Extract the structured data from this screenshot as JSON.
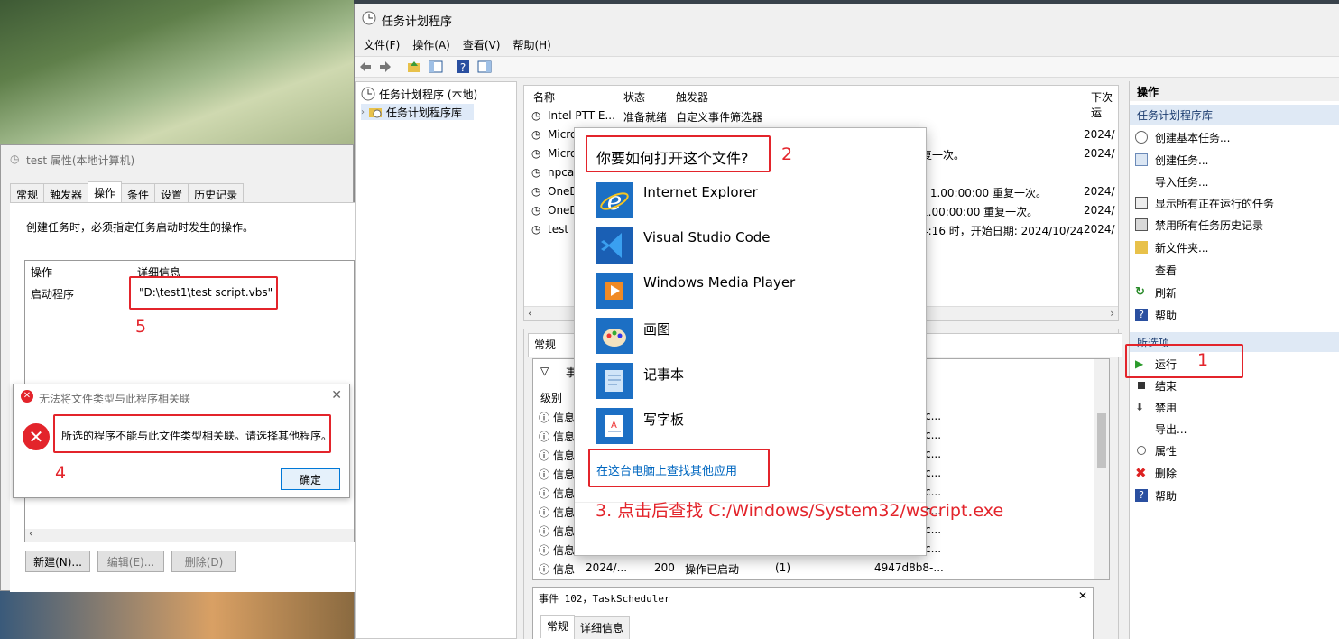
{
  "task_scheduler": {
    "title": "任务计划程序",
    "menu": [
      "文件(F)",
      "操作(A)",
      "查看(V)",
      "帮助(H)"
    ],
    "tree": {
      "root": "任务计划程序 (本地)",
      "library": "任务计划程序库"
    },
    "columns": [
      "名称",
      "状态",
      "触发器",
      "下次运"
    ],
    "rows": [
      {
        "name": "Intel PTT E...",
        "status": "准备就绪",
        "trigger": "自定义事件筛选器",
        "next": ""
      },
      {
        "name": "Micro",
        "status": "",
        "trigger": "",
        "next": "2024/"
      },
      {
        "name": "Micro",
        "status": "",
        "trigger": "复一次。",
        "next": "2024/"
      },
      {
        "name": "npcap",
        "status": "",
        "trigger": "",
        "next": ""
      },
      {
        "name": "OneD",
        "status": "",
        "trigger": "为 1.00:00:00 重复一次。",
        "next": "2024/"
      },
      {
        "name": "OneD",
        "status": "",
        "trigger": "1.00:00:00 重复一次。",
        "next": "2024/"
      },
      {
        "name": "test",
        "status": "",
        "trigger": "4:16 时，开始日期: 2024/10/24",
        "next": "2024/"
      }
    ],
    "lower_tab": "常规",
    "history_header": "事",
    "level_header": "级别",
    "events": [
      {
        "level": "信息",
        "tail": "c..."
      },
      {
        "level": "信息",
        "tail": "c..."
      },
      {
        "level": "信息",
        "tail": "c..."
      },
      {
        "level": "信息",
        "tail": "c..."
      },
      {
        "level": "信息",
        "tail": "c..."
      },
      {
        "level": "信息",
        "tail": "c..."
      },
      {
        "level": "信息",
        "tail": "c..."
      },
      {
        "level": "信息",
        "tail": "c..."
      },
      {
        "level": "信息",
        "tail": "..."
      },
      {
        "level": "信息",
        "date": "2024/...",
        "id": "200",
        "category": "操作已启动",
        "op": "(1)",
        "tail": "4947d8b8-..."
      }
    ],
    "event_panel": {
      "title": "事件 102，TaskScheduler",
      "tabs": [
        "常规",
        "详细信息"
      ],
      "close": "✕"
    },
    "behind_button": "确定"
  },
  "actions": {
    "header": "操作",
    "group1": "任务计划程序库",
    "items1": [
      "创建基本任务...",
      "创建任务...",
      "导入任务...",
      "显示所有正在运行的任务",
      "禁用所有任务历史记录",
      "新文件夹...",
      "查看",
      "刷新",
      "帮助"
    ],
    "group2": "所选项",
    "items2": [
      "运行",
      "结束",
      "禁用",
      "导出...",
      "属性",
      "删除",
      "帮助"
    ]
  },
  "props": {
    "title": "test 属性(本地计算机)",
    "tabs": [
      "常规",
      "触发器",
      "操作",
      "条件",
      "设置",
      "历史记录"
    ],
    "desc": "创建任务时，必须指定任务启动时发生的操作。",
    "col1": "操作",
    "col2": "详细信息",
    "row_action": "启动程序",
    "row_detail": "\"D:\\test1\\test script.vbs\"",
    "buttons": [
      "新建(N)...",
      "编辑(E)...",
      "删除(D)"
    ]
  },
  "error_dialog": {
    "title": "无法将文件类型与此程序相关联",
    "message": "所选的程序不能与此文件类型相关联。请选择其他程序。",
    "ok": "确定"
  },
  "open_with": {
    "title": "你要如何打开这个文件?",
    "apps": [
      "Internet Explorer",
      "Visual Studio Code",
      "Windows Media Player",
      "画图",
      "记事本",
      "写字板"
    ],
    "more_link": "在这台电脑上查找其他应用"
  },
  "annotations": {
    "n1": "1",
    "n2": "2",
    "n3": "3. 点击后查找  C:/Windows/System32/wscript.exe",
    "n4": "4",
    "n5": "5",
    "color": "#e3242b"
  }
}
